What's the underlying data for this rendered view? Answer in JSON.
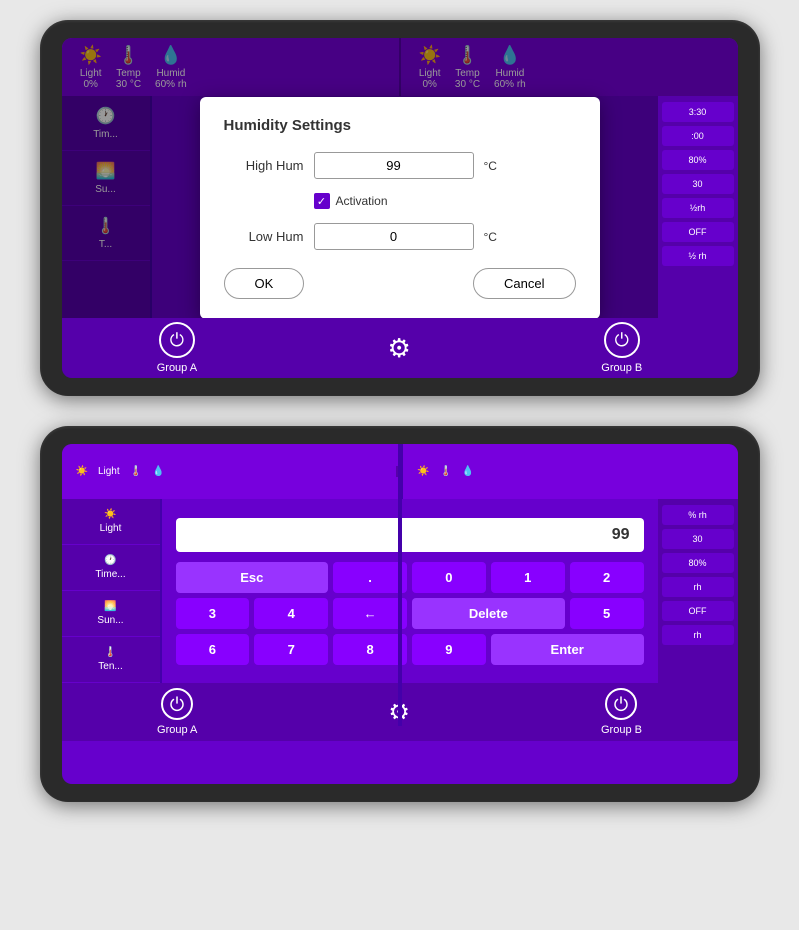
{
  "device1": {
    "status_bar": {
      "left_group": {
        "light_icon": "☀",
        "light_label": "Light",
        "light_value": "0%",
        "temp_icon": "🌡",
        "temp_label": "Temp",
        "temp_value": "30 °C",
        "humid_icon": "💧",
        "humid_label": "Humid",
        "humid_value": "60% rh"
      },
      "right_group": {
        "light_icon": "☀",
        "light_label": "Light",
        "light_value": "0%",
        "temp_icon": "🌡",
        "temp_label": "Temp",
        "temp_value": "30 °C",
        "humid_icon": "💧",
        "humid_label": "Humid",
        "humid_value": "60% rh"
      }
    },
    "sidebar": {
      "items": [
        {
          "label": "Tim..."
        },
        {
          "label": "Su..."
        },
        {
          "label": "T..."
        }
      ]
    },
    "right_panel": {
      "time": "3:30",
      "items": [
        ":00",
        "80%",
        "30",
        "½rh",
        "OFF",
        "½ rh"
      ]
    },
    "dialog": {
      "title": "Humidity Settings",
      "high_hum_label": "High Hum",
      "high_hum_value": "99",
      "high_hum_unit": "°C",
      "activation_label": "Activation",
      "low_hum_label": "Low Hum",
      "low_hum_value": "0",
      "low_hum_unit": "°C",
      "ok_label": "OK",
      "cancel_label": "Cancel"
    },
    "bottom": {
      "group_a_label": "Group A",
      "group_b_label": "Group B"
    }
  },
  "device2": {
    "status_bar": {
      "left": [
        {
          "icon": "☀",
          "label": "Light"
        },
        {
          "icon": "🌡",
          "label": ""
        },
        {
          "icon": "💧",
          "label": ""
        }
      ],
      "right": [
        {
          "icon": "☀",
          "label": ""
        },
        {
          "icon": "🌡",
          "label": ""
        },
        {
          "icon": "💧",
          "label": ""
        }
      ]
    },
    "sidebar": {
      "items": [
        {
          "icon": "☀",
          "label": "Light"
        },
        {
          "icon": "🕐",
          "label": "Time..."
        },
        {
          "icon": "☀",
          "label": "Sun..."
        },
        {
          "icon": "🌡",
          "label": "Ten..."
        }
      ]
    },
    "right_panel": {
      "items": [
        "% rh",
        "30",
        "80%",
        "rh",
        "OFF",
        "rh"
      ]
    },
    "numpad": {
      "display_value": "99",
      "buttons_row1": [
        "Esc",
        ".",
        "0",
        "1",
        "2",
        "3",
        "4",
        "←"
      ],
      "buttons_row2": [
        "Delete",
        "5",
        "6",
        "7",
        "8",
        "9",
        "Enter"
      ]
    },
    "bottom": {
      "group_a_label": "Group A",
      "group_b_label": "Group B"
    }
  }
}
